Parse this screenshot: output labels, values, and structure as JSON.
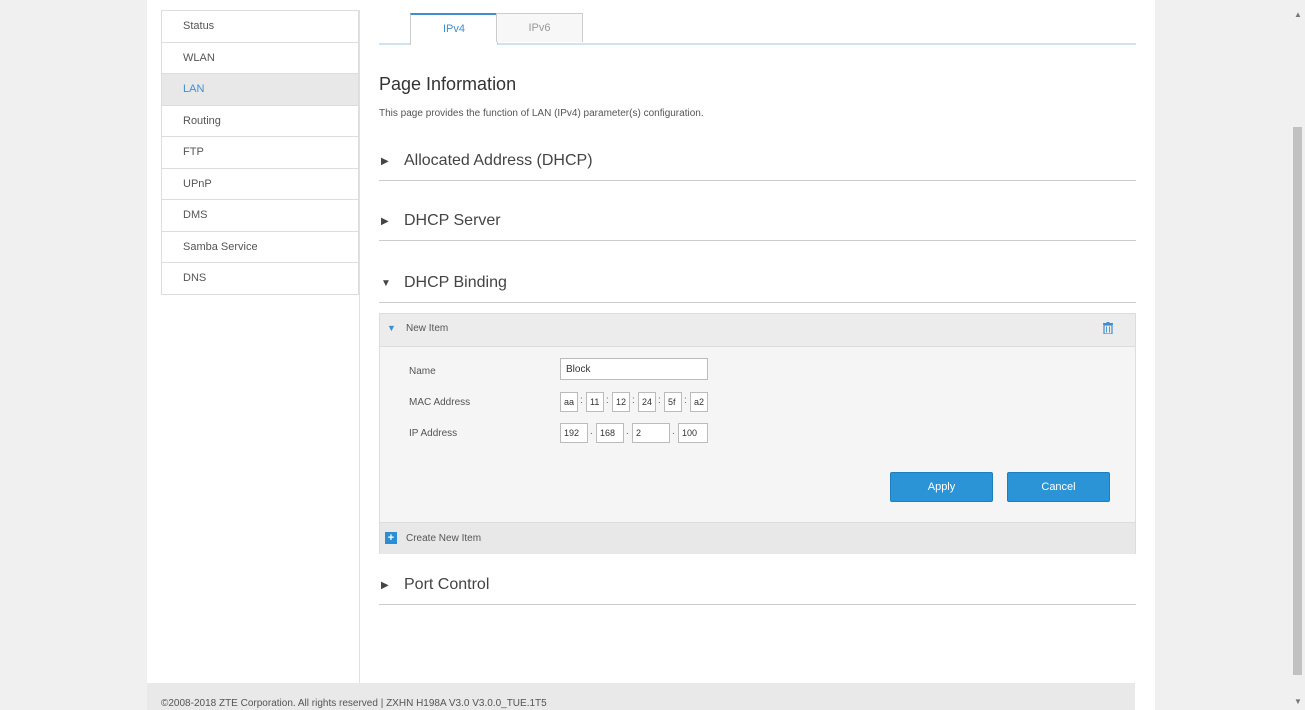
{
  "sidebar": {
    "items": [
      {
        "label": "Status"
      },
      {
        "label": "WLAN"
      },
      {
        "label": "LAN"
      },
      {
        "label": "Routing"
      },
      {
        "label": "FTP"
      },
      {
        "label": "UPnP"
      },
      {
        "label": "DMS"
      },
      {
        "label": "Samba Service"
      },
      {
        "label": "DNS"
      }
    ],
    "active": "LAN"
  },
  "tabs": {
    "ipv4": "IPv4",
    "ipv6": "IPv6",
    "active": "IPv4"
  },
  "main": {
    "title": "Page Information",
    "description": "This page provides the function of LAN (IPv4) parameter(s) configuration.",
    "sections": {
      "allocated": "Allocated Address (DHCP)",
      "dhcp_server": "DHCP Server",
      "dhcp_binding": "DHCP Binding",
      "port_control": "Port Control"
    }
  },
  "binding": {
    "item_title": "New Item",
    "name_label": "Name",
    "name_value": "Block",
    "mac_label": "MAC Address",
    "mac": [
      "aa",
      "11",
      "12",
      "24",
      "5f",
      "a2"
    ],
    "ip_label": "IP Address",
    "ip": [
      "192",
      "168",
      "2",
      "100"
    ],
    "apply": "Apply",
    "cancel": "Cancel",
    "create": "Create New Item"
  },
  "footer": {
    "text": "©2008-2018 ZTE Corporation. All rights reserved  |   ZXHN H198A V3.0 V3.0.0_TUE.1T5"
  },
  "icons": {
    "arrow_right": "▶",
    "arrow_down": "▼",
    "trash": "trash-icon",
    "plus": "+"
  },
  "colors": {
    "accent": "#2a94d6",
    "active_text": "#3f8fd0"
  }
}
